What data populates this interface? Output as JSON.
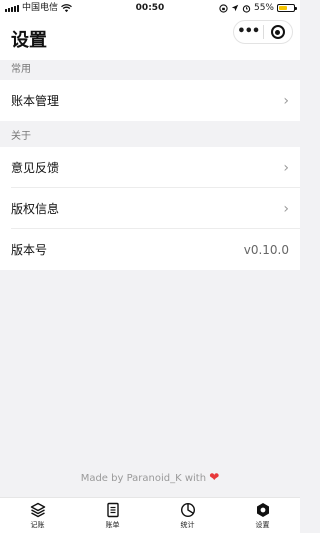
{
  "status_bar": {
    "carrier": "中国电信",
    "time": "00:50",
    "battery_percent": "55%",
    "battery_level": 0.55
  },
  "nav": {
    "title": "设置"
  },
  "sections": [
    {
      "header": "常用",
      "rows": [
        {
          "label": "账本管理",
          "has_chevron": true
        }
      ]
    },
    {
      "header": "关于",
      "rows": [
        {
          "label": "意见反馈",
          "has_chevron": true
        },
        {
          "label": "版权信息",
          "has_chevron": true
        },
        {
          "label": "版本号",
          "value": "v0.10.0"
        }
      ]
    }
  ],
  "footer": {
    "credit": "Made by Paranoid_K with",
    "heart": "❤"
  },
  "tabbar": {
    "tabs": [
      {
        "label": "记账",
        "icon": "layers-icon"
      },
      {
        "label": "账单",
        "icon": "document-icon"
      },
      {
        "label": "统计",
        "icon": "pie-chart-icon"
      },
      {
        "label": "设置",
        "icon": "hexagon-settings-icon",
        "active": true
      }
    ]
  },
  "colors": {
    "background": "#f2f2f4",
    "heart": "#e8393b",
    "battery": "#f5c400"
  }
}
